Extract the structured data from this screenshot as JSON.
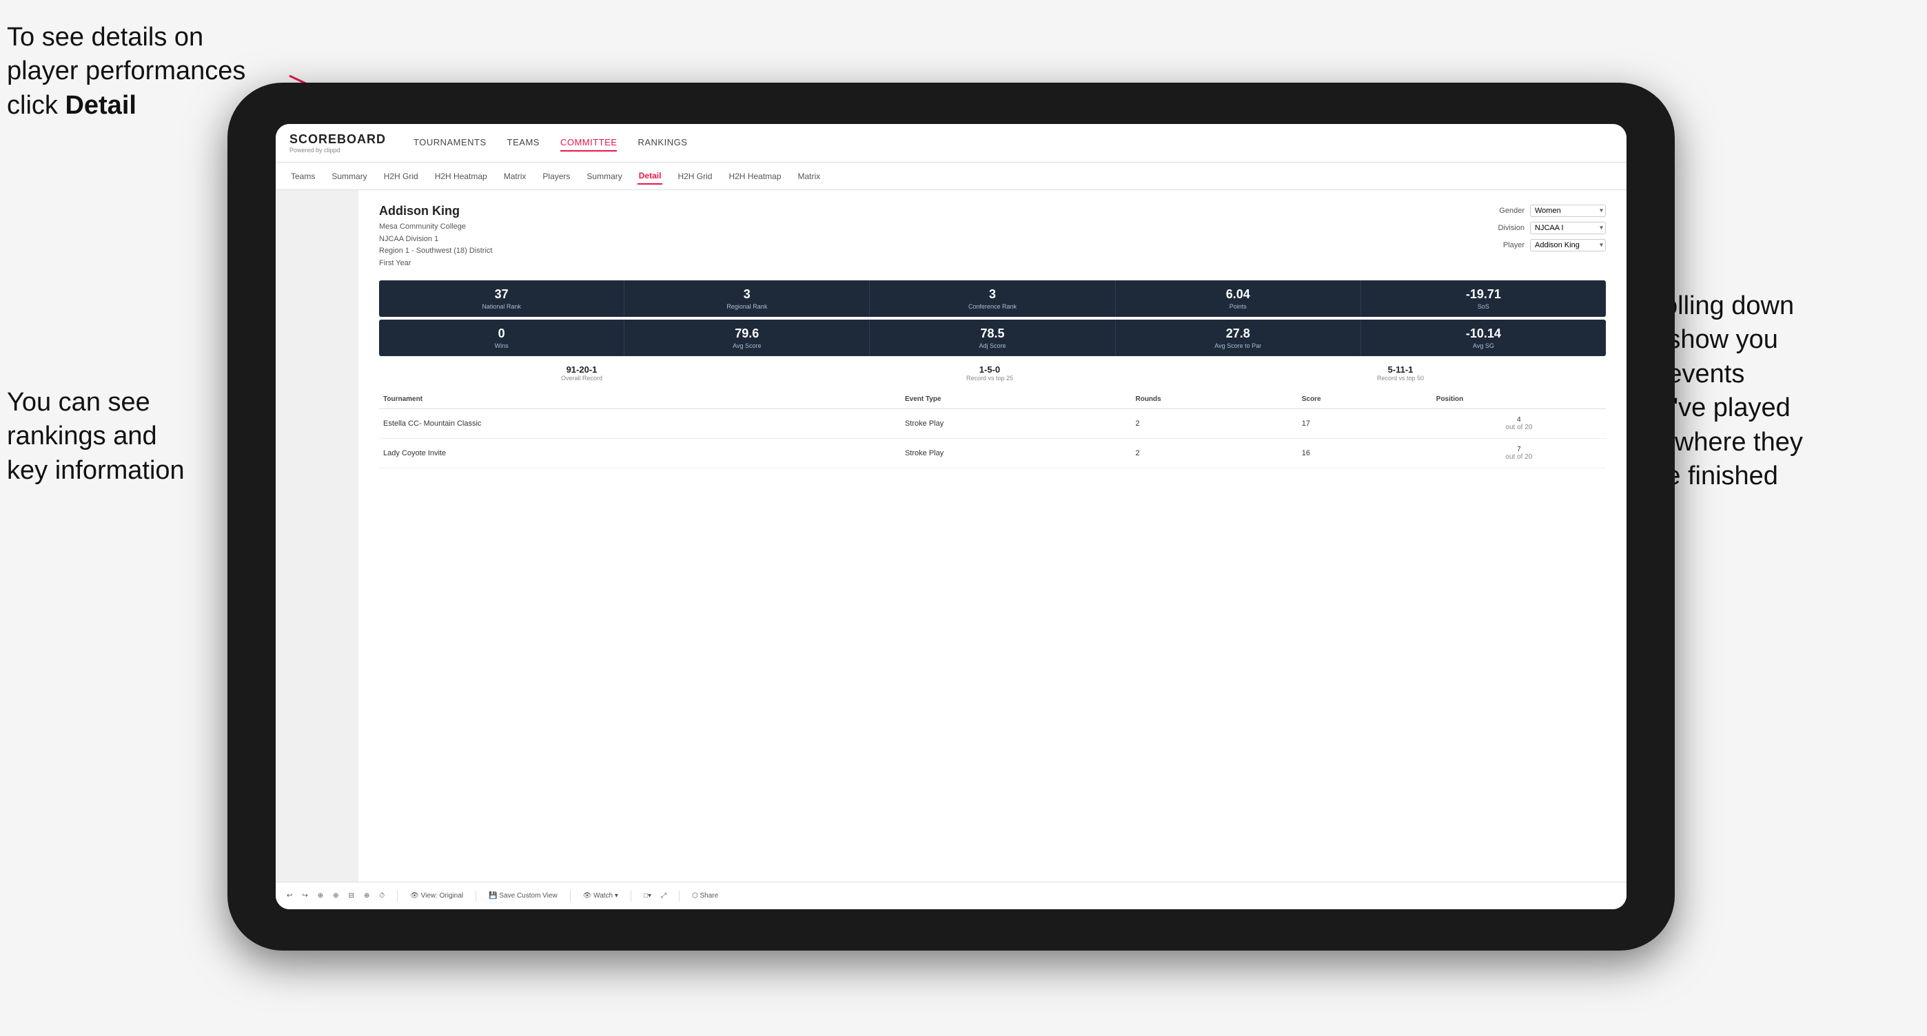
{
  "annotations": {
    "top_left": {
      "line1": "To see details on",
      "line2": "player performances",
      "line3_prefix": "click ",
      "line3_bold": "Detail"
    },
    "bottom_left": {
      "line1": "You can see",
      "line2": "rankings and",
      "line3": "key information"
    },
    "bottom_right": {
      "line1": "Scrolling down",
      "line2": "will show you",
      "line3": "the events",
      "line4": "they've played",
      "line5": "and where they",
      "line6": "have finished"
    }
  },
  "app": {
    "logo": "SCOREBOARD",
    "logo_sub": "Powered by clippd",
    "nav_items": [
      "TOURNAMENTS",
      "TEAMS",
      "COMMITTEE",
      "RANKINGS"
    ],
    "active_nav": "COMMITTEE",
    "sub_nav": [
      "Teams",
      "Summary",
      "H2H Grid",
      "H2H Heatmap",
      "Matrix",
      "Players",
      "Summary",
      "Detail",
      "H2H Grid",
      "H2H Heatmap",
      "Matrix"
    ],
    "active_sub": "Detail"
  },
  "player": {
    "name": "Addison King",
    "school": "Mesa Community College",
    "division": "NJCAA Division 1",
    "region": "Region 1 - Southwest (18) District",
    "year": "First Year"
  },
  "selects": {
    "gender_label": "Gender",
    "gender_value": "Women",
    "division_label": "Division",
    "division_value": "NJCAA I",
    "player_label": "Player",
    "player_value": "Addison King"
  },
  "stats_row1": [
    {
      "value": "37",
      "label": "National Rank"
    },
    {
      "value": "3",
      "label": "Regional Rank"
    },
    {
      "value": "3",
      "label": "Conference Rank"
    },
    {
      "value": "6.04",
      "label": "Points"
    },
    {
      "value": "-19.71",
      "label": "SoS"
    }
  ],
  "stats_row2": [
    {
      "value": "0",
      "label": "Wins"
    },
    {
      "value": "79.6",
      "label": "Avg Score"
    },
    {
      "value": "78.5",
      "label": "Adj Score"
    },
    {
      "value": "27.8",
      "label": "Avg Score to Par"
    },
    {
      "value": "-10.14",
      "label": "Avg SG"
    }
  ],
  "records": [
    {
      "value": "91-20-1",
      "label": "Overall Record"
    },
    {
      "value": "1-5-0",
      "label": "Record vs top 25"
    },
    {
      "value": "5-11-1",
      "label": "Record vs top 50"
    }
  ],
  "table_headers": [
    "Tournament",
    "Event Type",
    "Rounds",
    "Score",
    "Position"
  ],
  "table_rows": [
    {
      "tournament": "Estella CC- Mountain Classic",
      "event_type": "Stroke Play",
      "rounds": "2",
      "score": "17",
      "position": "4\nout of 20"
    },
    {
      "tournament": "Lady Coyote Invite",
      "event_type": "Stroke Play",
      "rounds": "2",
      "score": "16",
      "position": "7\nout of 20"
    }
  ],
  "toolbar": {
    "buttons": [
      "↩",
      "↪",
      "⊕",
      "⊕",
      "⊟•",
      "⊕",
      "⏱",
      "View: Original",
      "Save Custom View",
      "Watch ▾",
      "□▾",
      "⤢",
      "Share"
    ]
  }
}
